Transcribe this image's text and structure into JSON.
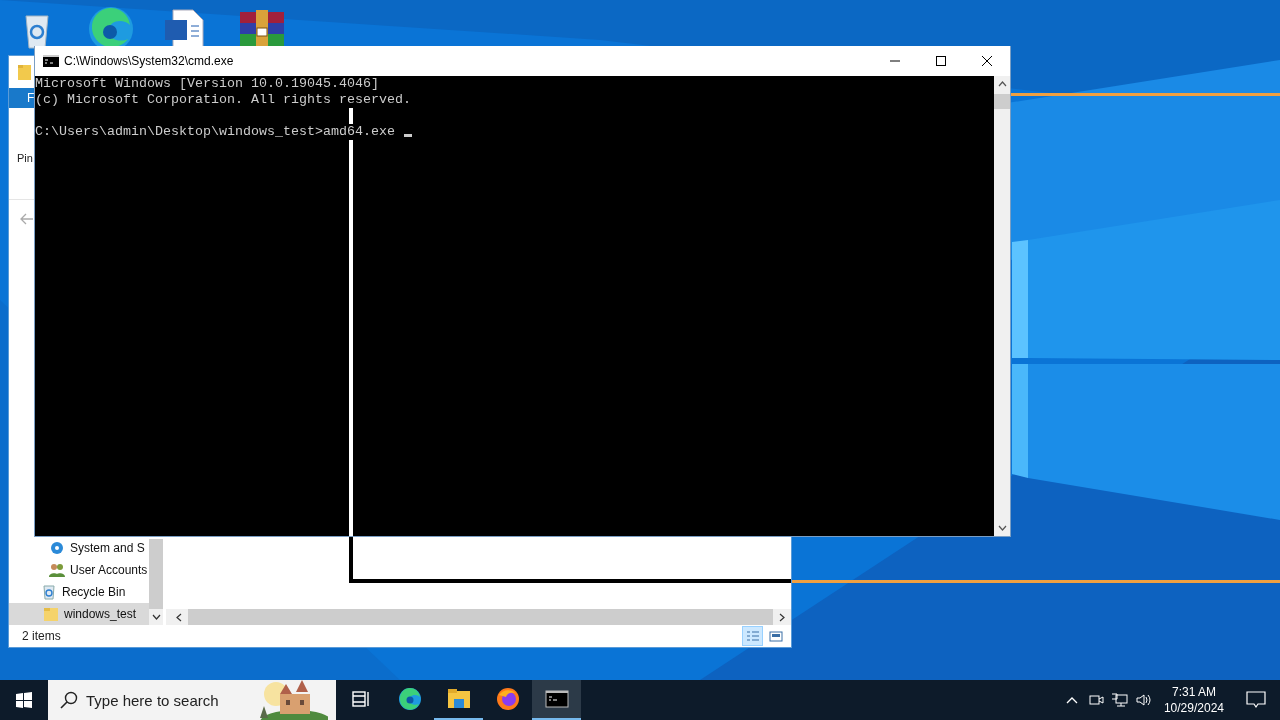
{
  "explorer_window": {
    "ribbon_tab": "F",
    "ribbon_label": "Pin",
    "nav_items": [
      {
        "label": "System and S",
        "kind": "settings",
        "selected": false
      },
      {
        "label": "User Accounts",
        "kind": "users",
        "selected": false
      },
      {
        "label": "Recycle Bin",
        "kind": "recycle",
        "selected": false
      },
      {
        "label": "windows_test",
        "kind": "folder",
        "selected": true
      }
    ],
    "status": "2 items",
    "views": [
      {
        "kind": "details",
        "selected": true
      },
      {
        "kind": "tiles",
        "selected": false
      }
    ]
  },
  "cmd_window": {
    "title": "C:\\Windows\\System32\\cmd.exe",
    "banner": [
      "Microsoft Windows [Version 10.0.19045.4046]",
      "(c) Microsoft Corporation. All rights reserved."
    ],
    "prompt": "C:\\Users\\admin\\Desktop\\windows_test>amd64.exe"
  },
  "taskbar": {
    "search": {
      "placeholder": "Type here to search"
    },
    "apps": [
      {
        "kind": "task-view",
        "running": false,
        "selected": false
      },
      {
        "kind": "edge",
        "running": false,
        "selected": false
      },
      {
        "kind": "explorer",
        "running": true,
        "selected": false
      },
      {
        "kind": "firefox",
        "running": false,
        "selected": false
      },
      {
        "kind": "terminal",
        "running": true,
        "selected": true
      }
    ],
    "clock": {
      "time": "7:31 AM",
      "date": "10/29/2024"
    }
  }
}
